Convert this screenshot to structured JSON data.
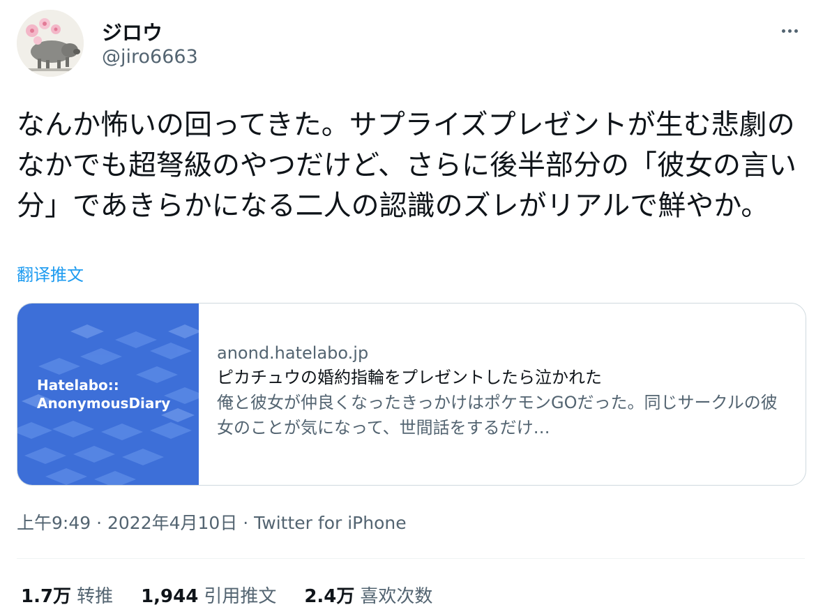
{
  "author": {
    "display_name": "ジロウ",
    "handle": "@jiro6663",
    "avatar_icon": "boar-with-flowers-avatar"
  },
  "tweet": {
    "text": "なんか怖いの回ってきた。サプライズプレゼントが生む悲劇のなかでも超弩級のやつだけど、さらに後半部分の「彼女の言い分」であきらかになる二人の認識のズレがリアルで鮮やか。",
    "translate_label": "翻译推文"
  },
  "card": {
    "thumb_logo_line1": "Hatelabo::",
    "thumb_logo_line2": "AnonymousDiary",
    "domain": "anond.hatelabo.jp",
    "title": "ピカチュウの婚約指輪をプレゼントしたら泣かれた",
    "description": "俺と彼女が仲良くなったきっかけはポケモンGOだった。同じサークルの彼女のことが気になって、世間話をするだけ…"
  },
  "meta": {
    "timestamp": "上午9:49 · 2022年4月10日 · Twitter for iPhone"
  },
  "stats": [
    {
      "count": "1.7万",
      "label": "转推"
    },
    {
      "count": "1,944",
      "label": "引用推文"
    },
    {
      "count": "2.4万",
      "label": "喜欢次数"
    }
  ],
  "colors": {
    "link": "#1d9bf0",
    "secondary_text": "#536471",
    "card_thumb_bg": "#3d6fd8"
  }
}
